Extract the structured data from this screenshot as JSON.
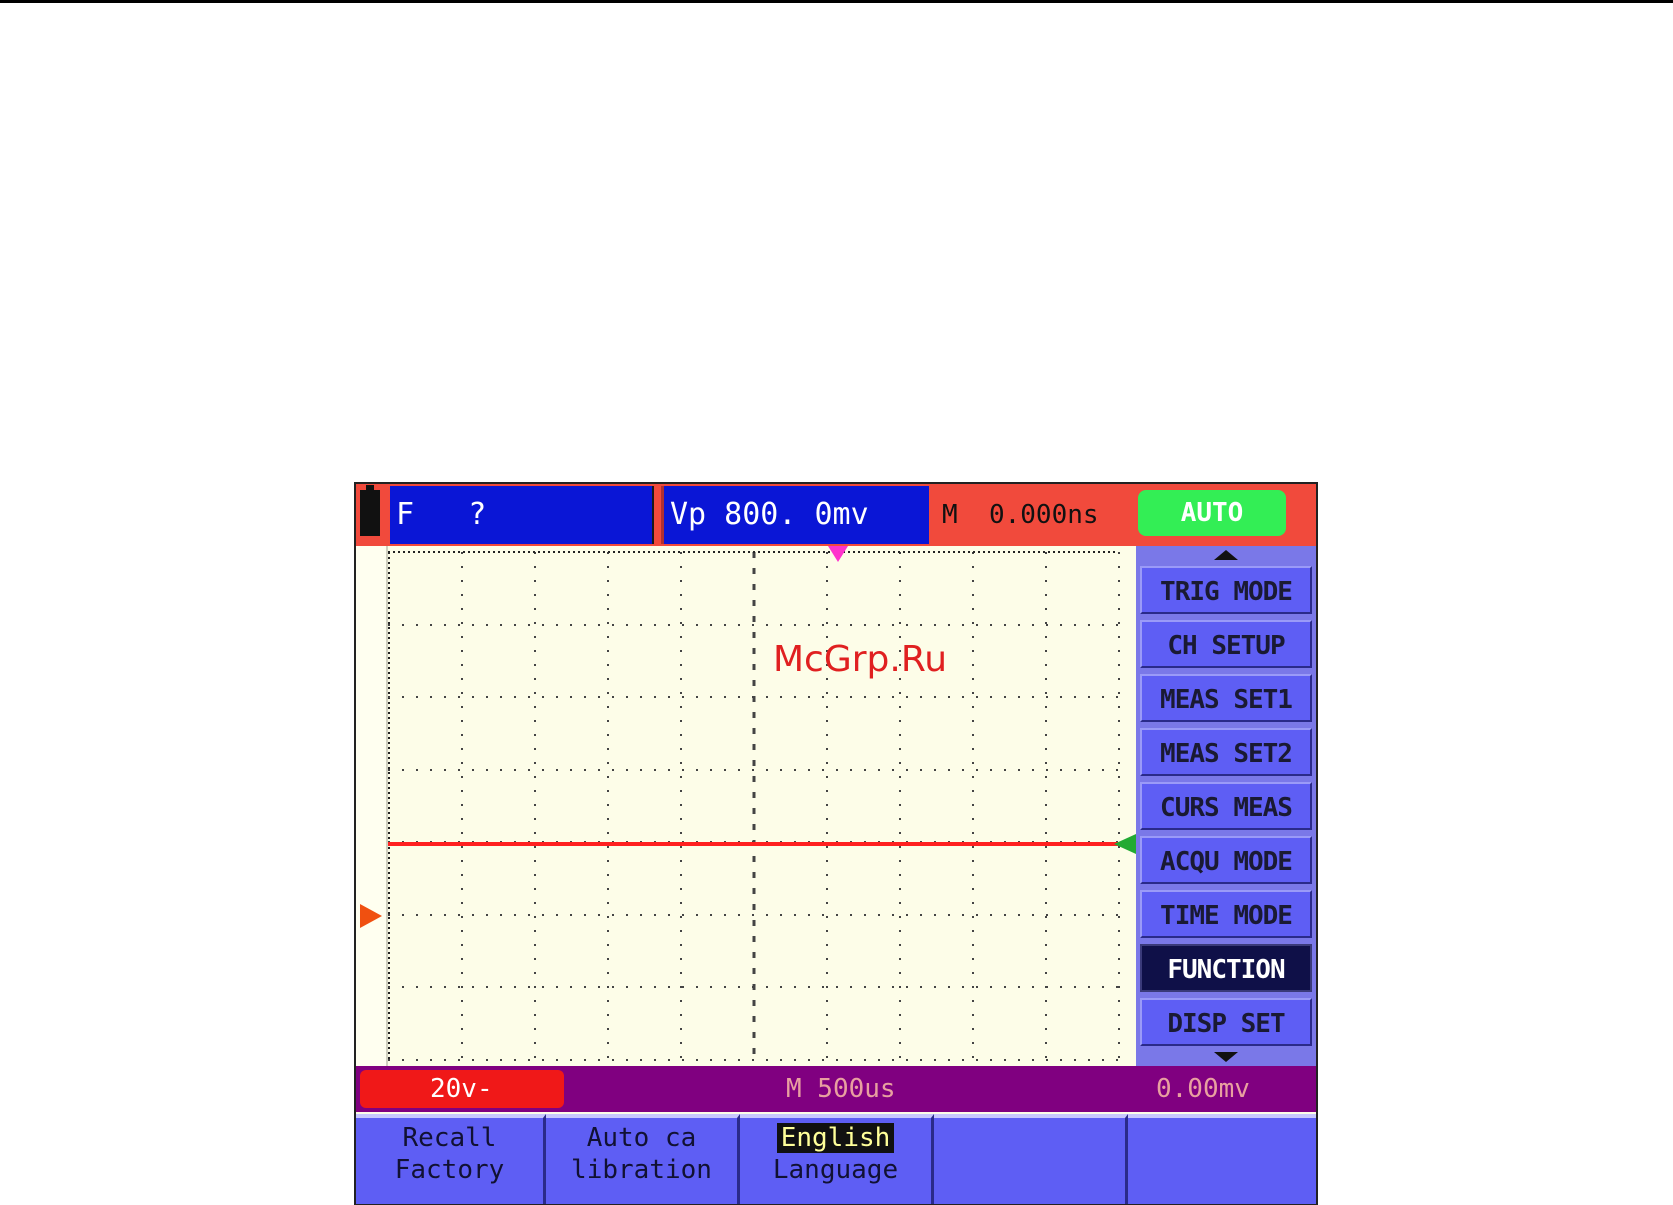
{
  "topbar": {
    "frequency_label": "F   ?",
    "vp_readout": "Vp 800. 0mv",
    "timebase": "M  0.000ns",
    "mode_badge": "AUTO"
  },
  "watermark": "McGrp.Ru",
  "side_menu": {
    "items": [
      {
        "label": "TRIG MODE"
      },
      {
        "label": "CH SETUP"
      },
      {
        "label": "MEAS SET1"
      },
      {
        "label": "MEAS SET2"
      },
      {
        "label": "CURS MEAS"
      },
      {
        "label": "ACQU MODE"
      },
      {
        "label": "TIME MODE"
      },
      {
        "label": "FUNCTION",
        "selected": true
      },
      {
        "label": "DISP SET"
      }
    ]
  },
  "statusbar": {
    "volts_per_div": "20v-",
    "time_per_div": "M 500us",
    "trigger_level": "0.00mv"
  },
  "softkeys": [
    {
      "line1": "Recall",
      "line2": "Factory"
    },
    {
      "line1": "Auto ca",
      "line2": "libration"
    },
    {
      "line1": "English",
      "line2": "Language"
    },
    {
      "line1": "",
      "line2": ""
    },
    {
      "line1": "",
      "line2": ""
    }
  ],
  "colors": {
    "topbar_bg": "#f14a3c",
    "readout_box": "#0a16d6",
    "auto_badge": "#33ee55",
    "menu_bg": "#5e5ef4",
    "status_bg": "#800080",
    "trace": "#ff2020"
  }
}
